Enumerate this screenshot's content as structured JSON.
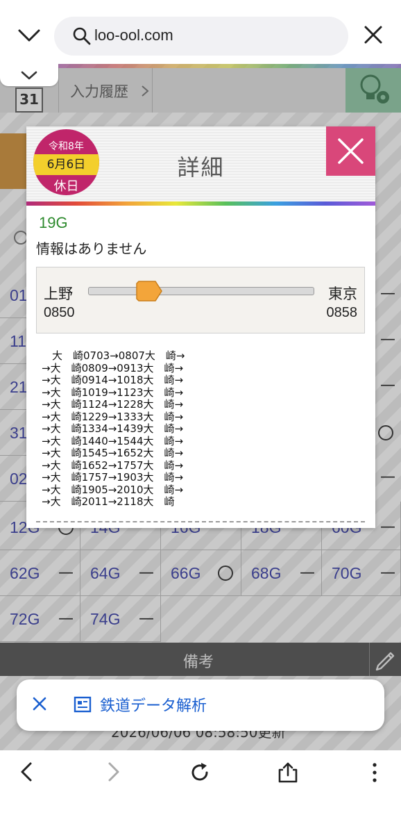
{
  "browser": {
    "url": "loo-ool.com"
  },
  "page": {
    "calendar_icon_text": "31",
    "history_label": "入力履歴",
    "grid": [
      {
        "label": "01"
      },
      {
        "label": "11"
      },
      {
        "label": "21"
      },
      {
        "label": "31"
      },
      {
        "label": "02"
      },
      {
        "label": "12G",
        "mark": "circle"
      },
      {
        "label": "14G"
      },
      {
        "label": "16G"
      },
      {
        "label": "18G"
      },
      {
        "label": "60G"
      }
    ],
    "grid_row_62": [
      {
        "label": "62G",
        "mark": "—"
      },
      {
        "label": "64G",
        "mark": "—"
      },
      {
        "label": "66G",
        "mark": "circle"
      },
      {
        "label": "68G",
        "mark": "—"
      },
      {
        "label": "70G",
        "mark": "—"
      }
    ],
    "grid_row_72": [
      {
        "label": "72G",
        "mark": "—"
      },
      {
        "label": "74G",
        "mark": "—"
      }
    ],
    "remarks_label": "備考",
    "updated_text": "2026/06/06 08:58:50更新"
  },
  "modal": {
    "date_badge": {
      "era": "令和8年",
      "month_day": "6月6日",
      "kind": "休日",
      "color": "#c0256a",
      "band_color": "#f3cf2c"
    },
    "title": "詳細",
    "line_name": "19G",
    "info": "情報はありません",
    "progress": {
      "from_station": "上野",
      "to_station": "東京",
      "from_time": "0850",
      "to_time": "0858",
      "position": 0.27
    },
    "timetable": [
      "　大　崎0703→0807大　崎→",
      "→大　崎0809→0913大　崎→",
      "→大　崎0914→1018大　崎→",
      "→大　崎1019→1123大　崎→",
      "→大　崎1124→1228大　崎→",
      "→大　崎1229→1333大　崎→",
      "→大　崎1334→1439大　崎→",
      "→大　崎1440→1544大　崎→",
      "→大　崎1545→1652大　崎→",
      "→大　崎1652→1757大　崎→",
      "→大　崎1757→1903大　崎→",
      "→大　崎1905→2010大　崎→",
      "→大　崎2011→2118大　崎"
    ]
  },
  "toast": {
    "text": "鉄道データ解析",
    "color": "#1a5fd0"
  }
}
